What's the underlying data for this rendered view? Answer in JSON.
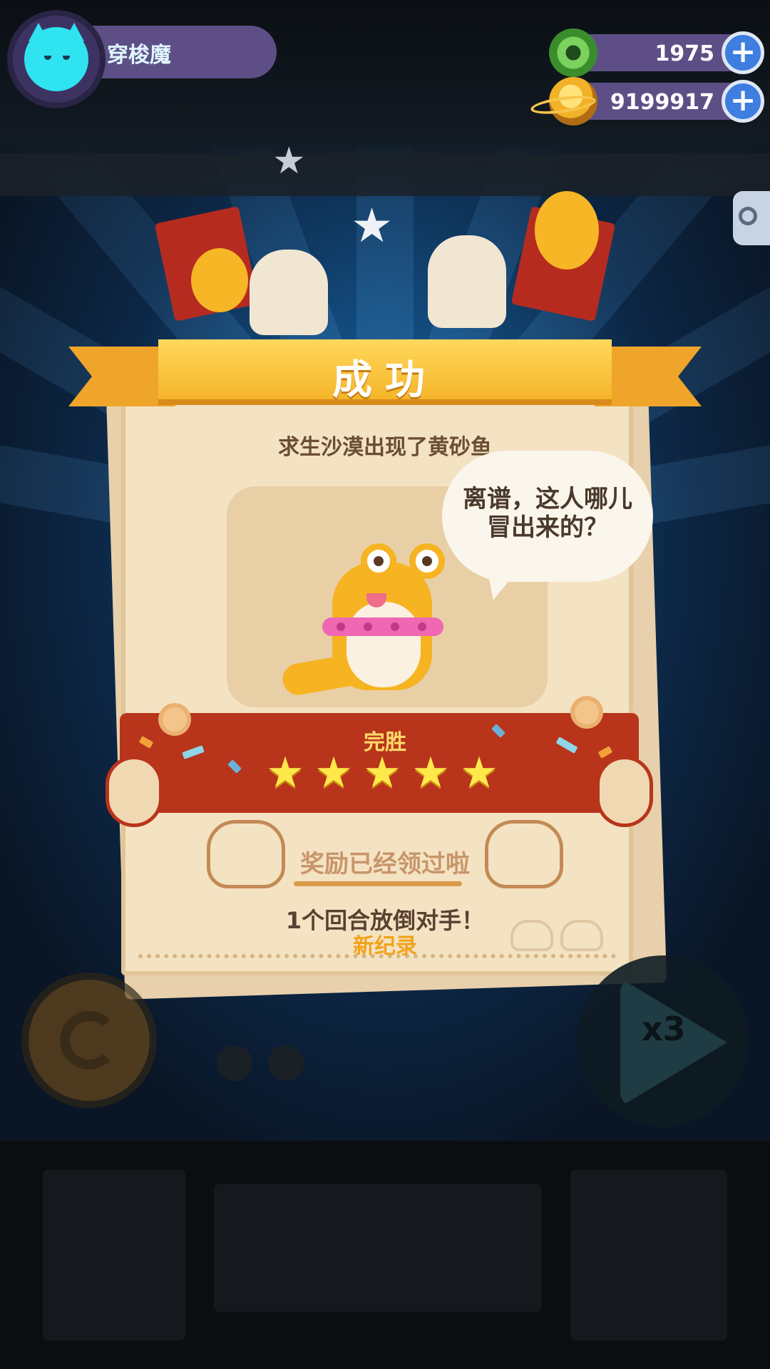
{
  "player": {
    "name": "穿梭魔",
    "avatar_icon": "cyan-cat-avatar-icon"
  },
  "resources": [
    {
      "icon": "green-gem-icon",
      "value": "1975",
      "add_label": "+"
    },
    {
      "icon": "gold-planet-coin-icon",
      "value": "9199917",
      "add_label": "+"
    }
  ],
  "result_card": {
    "title": "成功",
    "subtitle": "求生沙漠出现了黄砂鱼",
    "speech": "离谱，这人哪儿冒出来的？",
    "result_label": "完胜",
    "stars": {
      "earned": 5,
      "total": 5,
      "glyph": "★"
    },
    "reward_status": "奖励已经领过啦",
    "round_text": "1个回合放倒对手！",
    "record_text": "新纪录"
  },
  "controls": {
    "retry_icon": "refresh-icon",
    "speed_label": "x3"
  },
  "colors": {
    "banner_gold": "#f5b52a",
    "band_red": "#b8341b",
    "card_bg": "#f4e3c3",
    "star_yellow": "#ffe84a",
    "record_orange": "#f2a21c"
  }
}
